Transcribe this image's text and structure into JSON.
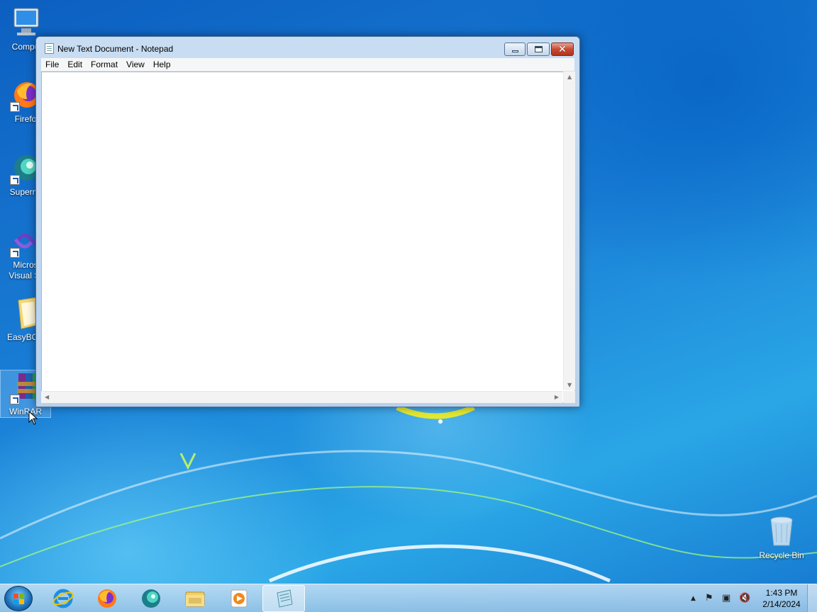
{
  "desktop": {
    "icons": [
      {
        "label": "Compu",
        "icon": "computer-icon"
      },
      {
        "label": "Firefo",
        "icon": "firefox-icon"
      },
      {
        "label": "Supermi",
        "icon": "supermium-icon"
      },
      {
        "label": "Micros",
        "label2": "Visual St",
        "icon": "visual-studio-icon"
      },
      {
        "label": "EasyBCD",
        "icon": "folder-icon"
      },
      {
        "label": "WinRAR",
        "icon": "winrar-icon"
      },
      {
        "label": "Recycle Bin",
        "icon": "recycle-bin-icon"
      }
    ]
  },
  "notepad": {
    "title": "New Text Document - Notepad",
    "menu": [
      "File",
      "Edit",
      "Format",
      "View",
      "Help"
    ],
    "content": ""
  },
  "taskbar": {
    "pinned": [
      {
        "name": "internet-explorer",
        "icon": "internet-explorer-icon"
      },
      {
        "name": "firefox",
        "icon": "firefox-icon"
      },
      {
        "name": "supermium",
        "icon": "supermium-icon"
      },
      {
        "name": "file-explorer",
        "icon": "folder-icon"
      },
      {
        "name": "media-player",
        "icon": "media-player-icon"
      },
      {
        "name": "notepad",
        "icon": "notepad-icon",
        "active": true
      }
    ],
    "clock": {
      "time": "1:43 PM",
      "date": "2/14/2024"
    }
  },
  "colors": {
    "accent": "#1a7fd6",
    "close_button": "#c74a32",
    "window_frame": "#c9ddf2"
  }
}
